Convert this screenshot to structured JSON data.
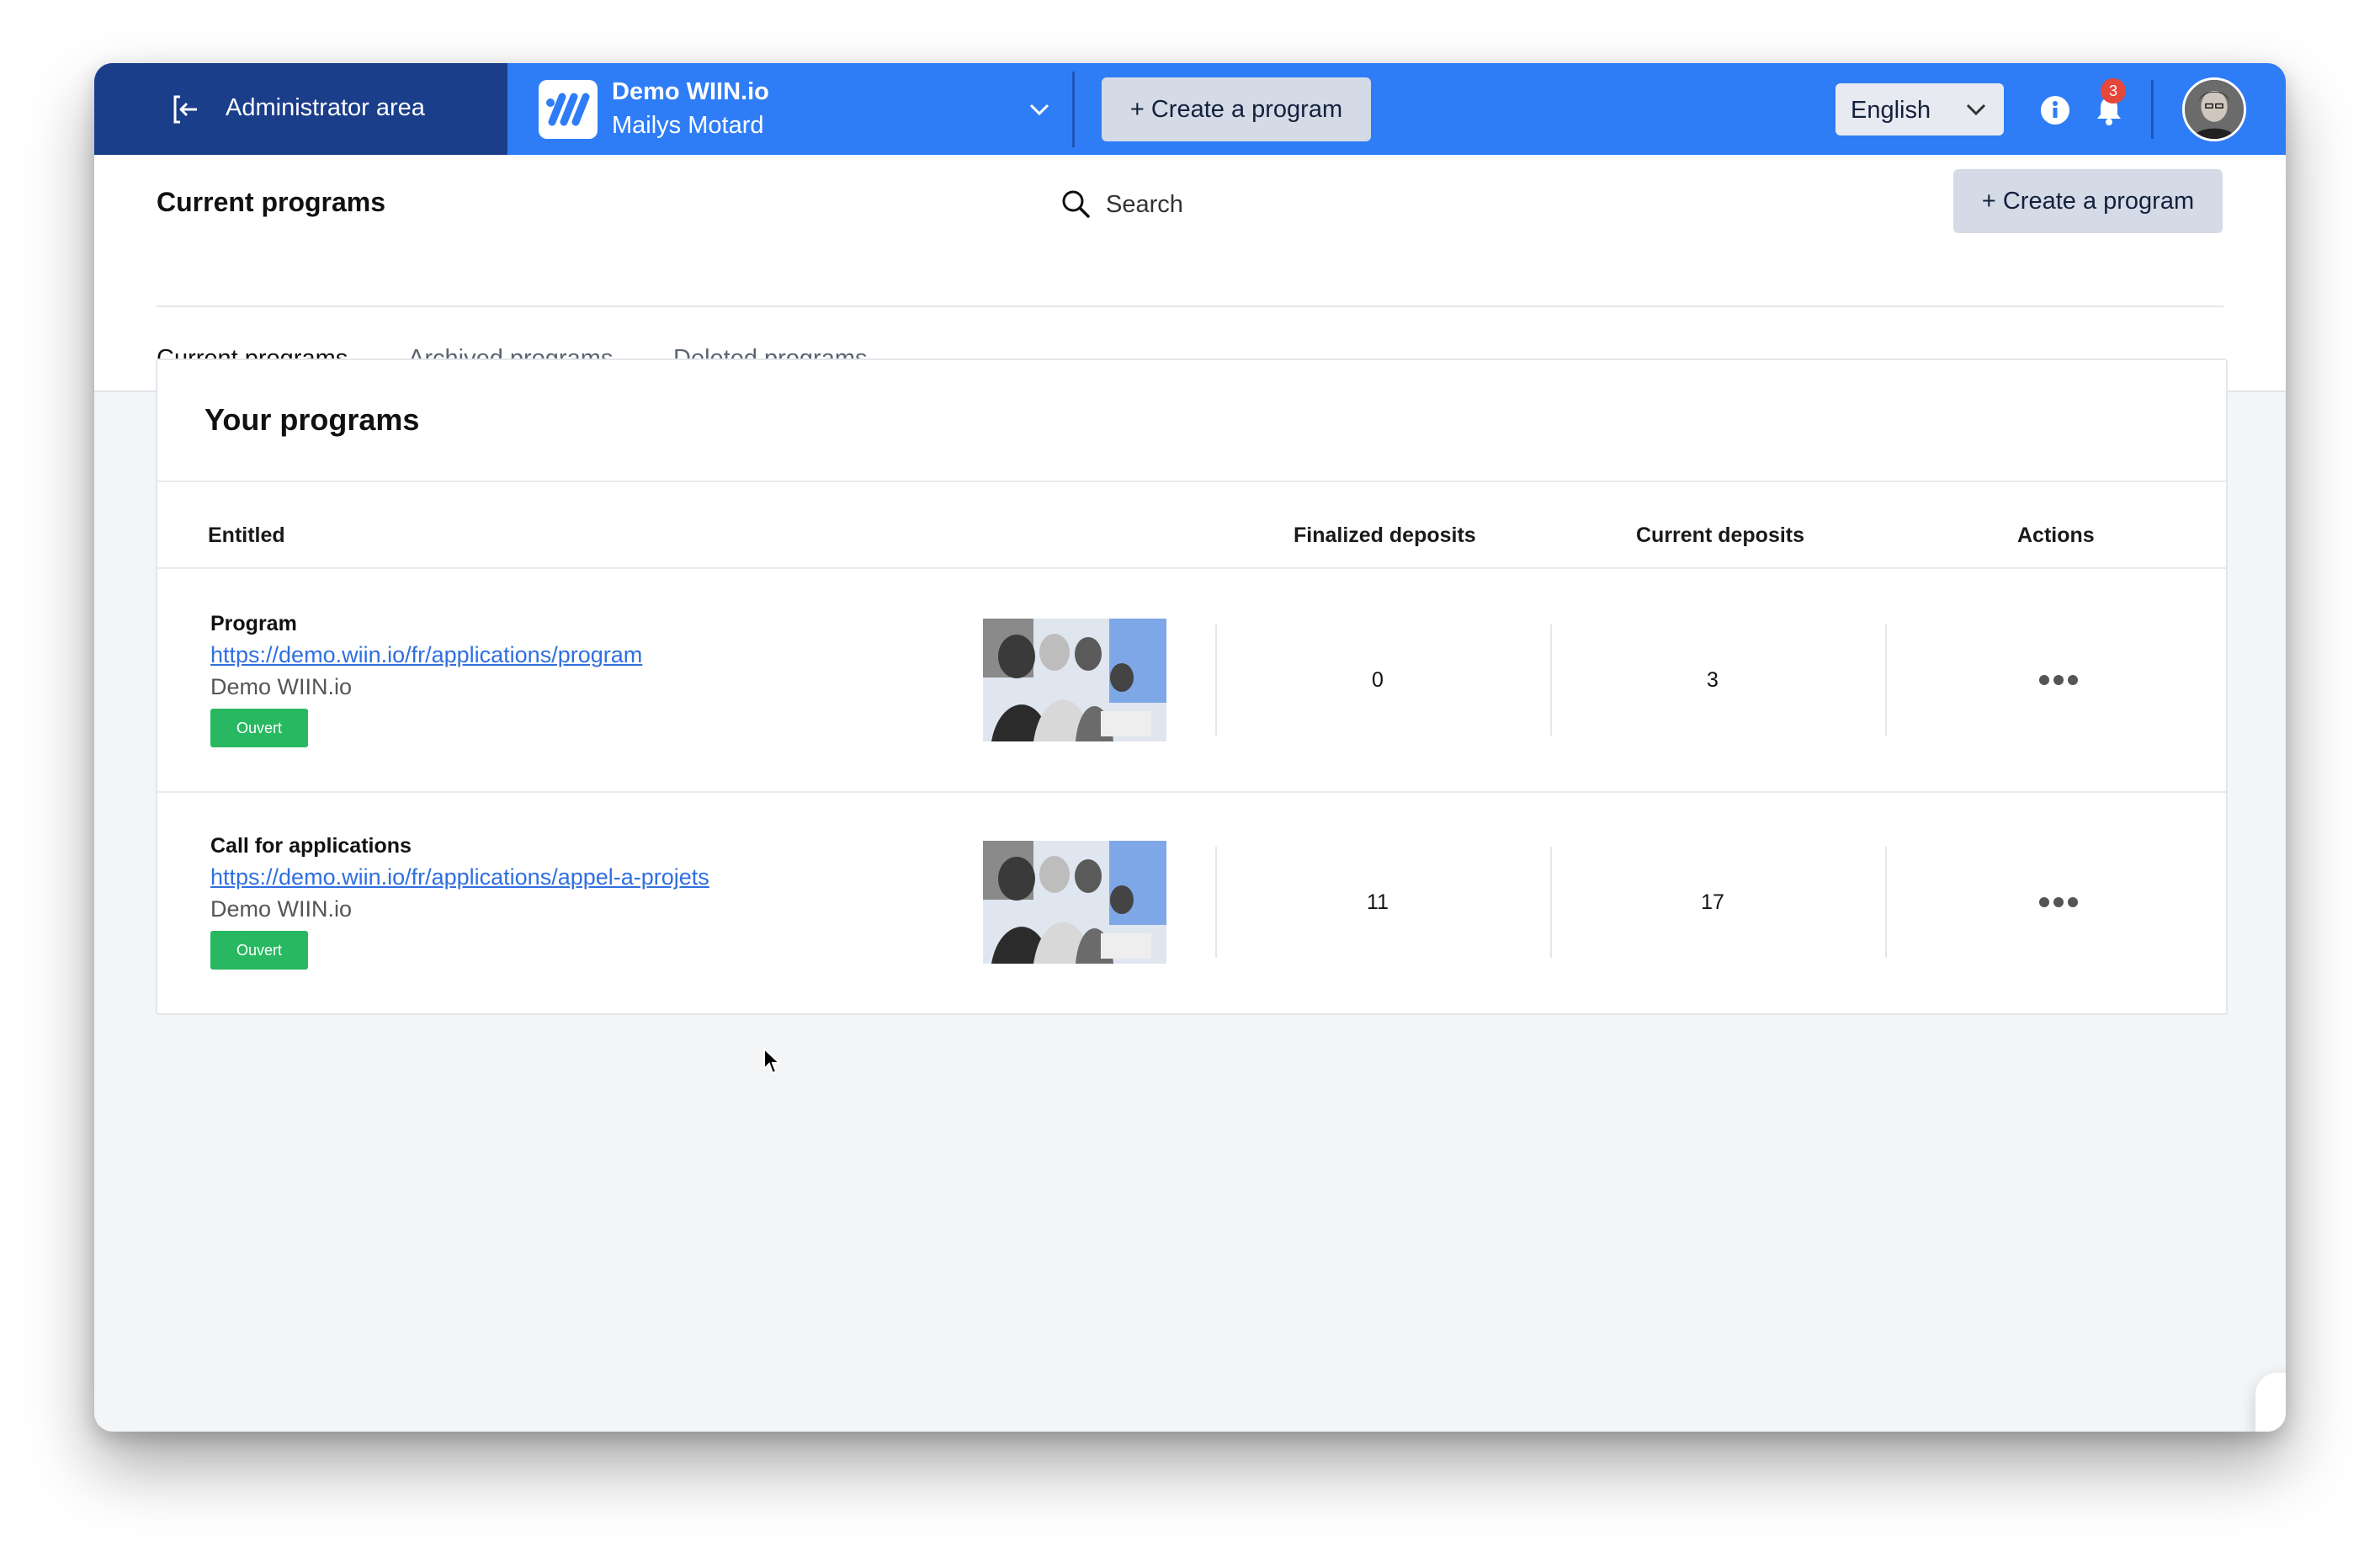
{
  "topbar": {
    "admin_label": "Administrator area",
    "org_name": "Demo WIIN.io",
    "org_user": "Mailys Motard",
    "create_label": "+ Create a program",
    "language": "English",
    "notification_count": "3",
    "accent_color": "#2f7df6",
    "admin_color": "#1b3e8a"
  },
  "header": {
    "title": "Current programs",
    "search_placeholder": "Search",
    "create_label": "+ Create a program"
  },
  "tabs": [
    {
      "label": "Current programs",
      "active": true
    },
    {
      "label": "Archived programs",
      "active": false
    },
    {
      "label": "Deleted programs",
      "active": false
    }
  ],
  "programs_card": {
    "title": "Your programs",
    "columns": [
      "Entitled",
      "Finalized deposits",
      "Current deposits",
      "Actions"
    ],
    "rows": [
      {
        "name": "Program",
        "link": "https://demo.wiin.io/fr/applications/program",
        "org": "Demo WIIN.io",
        "status": "Ouvert",
        "finalized": "0",
        "current": "3"
      },
      {
        "name": "Call for applications",
        "link": "https://demo.wiin.io/fr/applications/appel-a-projets",
        "org": "Demo WIIN.io",
        "status": "Ouvert",
        "finalized": "11",
        "current": "17"
      }
    ]
  },
  "help_button": {
    "glyph": "✌"
  },
  "icons": [
    "exit-icon",
    "wiin-logo-icon",
    "chevron-down-icon",
    "info-icon",
    "bell-icon",
    "search-icon",
    "more-dots-icon",
    "cursor-icon"
  ],
  "status_color": "#29b862"
}
